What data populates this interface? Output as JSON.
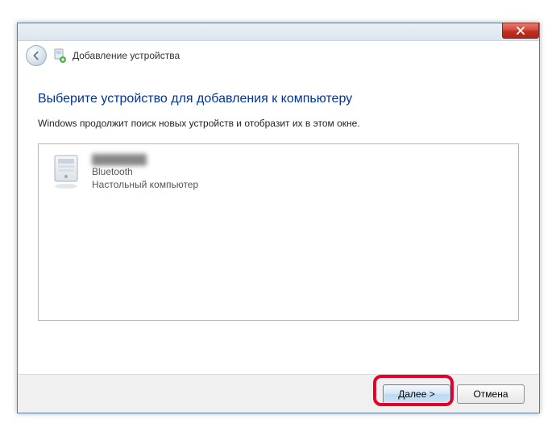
{
  "titlebar": {
    "breadcrumb": "Добавление устройства"
  },
  "content": {
    "heading": "Выберите устройство для добавления к компьютеру",
    "subheading": "Windows продолжит поиск новых устройств и отобразит их в этом окне."
  },
  "devices": [
    {
      "name": "████████",
      "protocol": "Bluetooth",
      "kind": "Настольный компьютер"
    }
  ],
  "buttons": {
    "next": "Далее >",
    "cancel": "Отмена"
  }
}
